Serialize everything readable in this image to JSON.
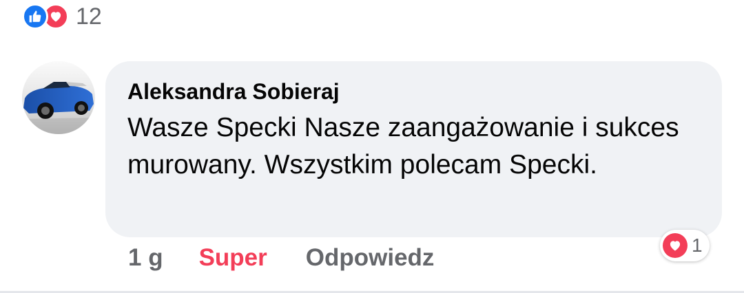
{
  "reactions_summary": {
    "icons": [
      "like-icon",
      "love-icon"
    ],
    "count": "12",
    "colors": {
      "like": "#1877f2",
      "love": "#f33e58"
    }
  },
  "comment": {
    "author": "Aleksandra Sobieraj",
    "text": "Wasze Specki Nasze zaangażowanie i sukces murowany. Wszystkim polecam Specki.",
    "time": "1 g",
    "reaction_label": "Super",
    "reply_label": "Odpowiedz",
    "reactions": {
      "icon": "love-icon",
      "count": "1"
    }
  },
  "colors": {
    "bubble_bg": "#f0f2f5",
    "text_primary": "#050505",
    "text_secondary": "#65676b",
    "accent_super": "#f33e58"
  }
}
